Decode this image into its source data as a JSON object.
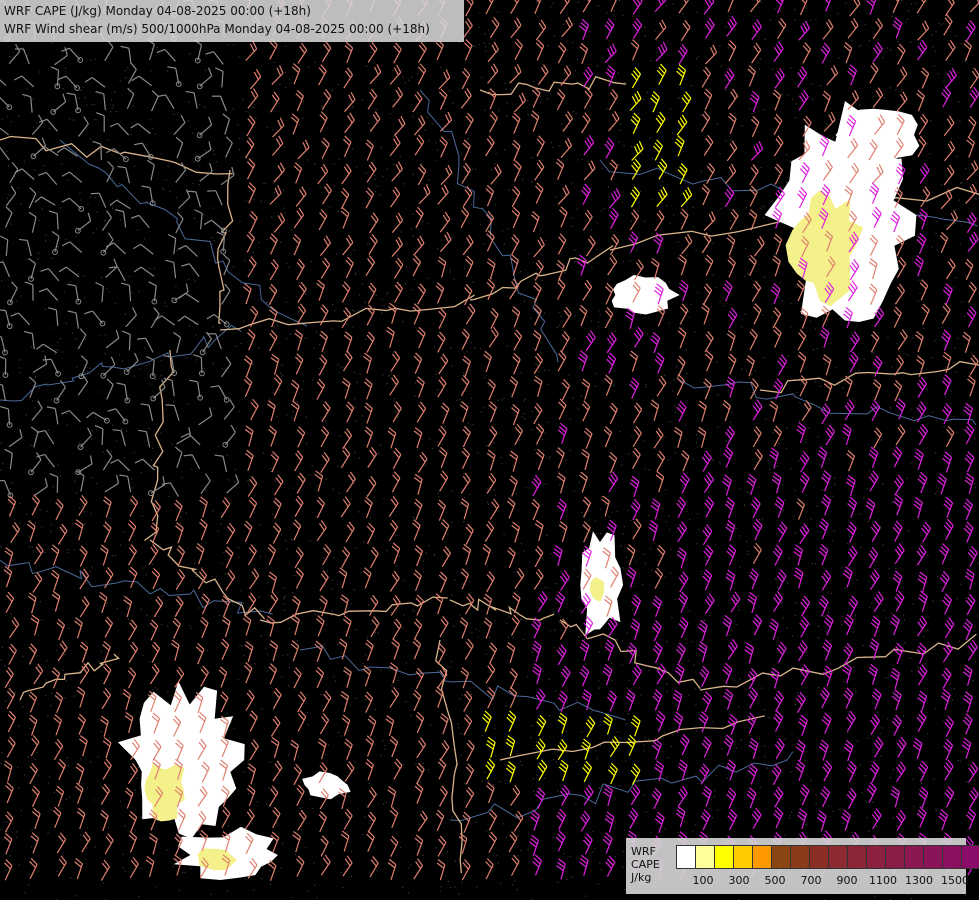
{
  "header": {
    "line1": "WRF CAPE (J/kg) Monday 04-08-2025 00:00 (+18h)",
    "line2": "WRF Wind shear (m/s) 500/1000hPa Monday 04-08-2025 00:00 (+18h)"
  },
  "legend": {
    "title_lines": [
      "WRF",
      "CAPE",
      "J/kg"
    ],
    "colors": [
      "#ffffff",
      "#ffff99",
      "#ffff00",
      "#ffcc00",
      "#ff9900",
      "#8b4513",
      "#8b3a1a",
      "#8b2f26",
      "#8b2a30",
      "#8b2538",
      "#8b2040",
      "#8b1c48",
      "#8b1850",
      "#8b1458",
      "#8b1060",
      "#8b0c68"
    ],
    "tick_labels": [
      "100",
      "300",
      "500",
      "700",
      "900",
      "1100",
      "1300",
      "1500"
    ]
  },
  "colors": {
    "barb_salmon": "#e08070",
    "barb_magenta": "#e020e0",
    "barb_yellow": "#ffff00",
    "barb_gray": "#8a8a8a",
    "border": "#d9b48a",
    "river": "#4a6a9a",
    "cape_white": "#ffffff",
    "cape_yellow": "#f4f08a"
  }
}
